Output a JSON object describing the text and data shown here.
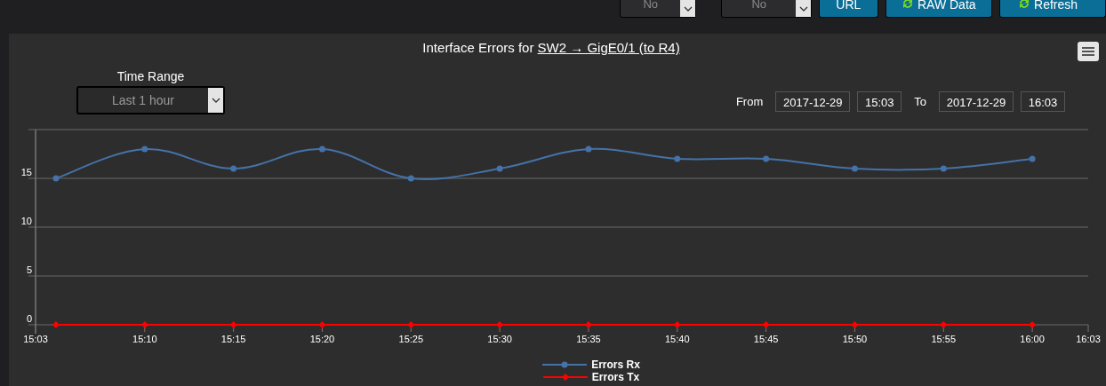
{
  "top_bar": {
    "selects": [
      {
        "value": "No"
      },
      {
        "value": "No"
      }
    ],
    "buttons": [
      {
        "label": "URL",
        "kind": "plain"
      },
      {
        "label": "RAW Data",
        "kind": "refresh"
      },
      {
        "label": "Refresh",
        "kind": "refresh"
      }
    ]
  },
  "panel": {
    "title": "Interface Errors for ",
    "title_link": "SW2 → GigE0/1 (to R4)",
    "time_range": {
      "label": "Time Range",
      "value": "Last 1 hour"
    },
    "range": {
      "from_label": "From",
      "from_date": "2017-12-29",
      "from_time": "15:03",
      "to_label": "To",
      "to_date": "2017-12-29",
      "to_time": "16:03"
    },
    "x_axis_start": "15:03",
    "x_axis_end": "16:03",
    "chart_data": {
      "type": "line",
      "grid": true,
      "categories": [
        null,
        "15:10",
        "15:15",
        "15:20",
        "15:25",
        "15:30",
        "15:35",
        "15:40",
        "15:45",
        "15:50",
        "15:55",
        "16:00"
      ],
      "ylim": [
        0,
        20
      ],
      "yticks": [
        0,
        5,
        10,
        15
      ],
      "series": [
        {
          "name": "Errors Rx",
          "color": "#4572a7",
          "marker": "circle",
          "values": [
            15,
            18,
            16,
            18,
            15,
            16,
            18,
            17,
            17,
            16,
            16,
            17
          ]
        },
        {
          "name": "Errors Tx",
          "color": "#ff0000",
          "marker": "diamond",
          "values": [
            0,
            0,
            0,
            0,
            0,
            0,
            0,
            0,
            0,
            0,
            0,
            0
          ]
        }
      ]
    }
  }
}
